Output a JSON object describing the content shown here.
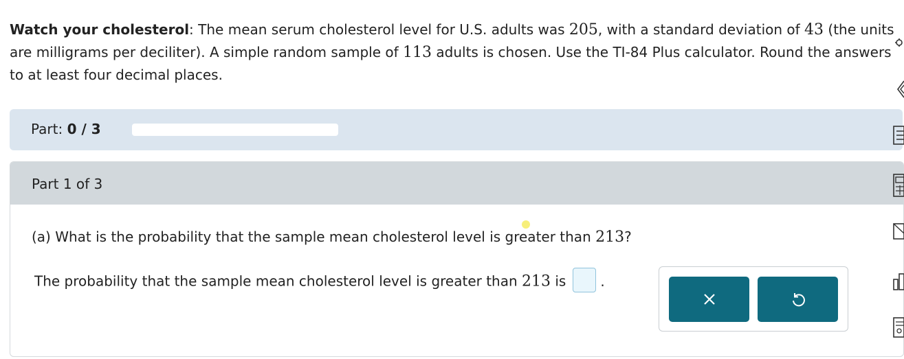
{
  "intro": {
    "title": "Watch your cholesterol",
    "colon": ": ",
    "t1": "The mean serum cholesterol level for U.S. adults was ",
    "mean": "205",
    "t2": ", with a standard deviation of ",
    "sd": "43",
    "t3": " (the units are milligrams per deciliter). A simple random sample of ",
    "n": "113",
    "t4": " adults is chosen. Use the TI-84 Plus calculator. Round the answers to at least four decimal places."
  },
  "part_bar": {
    "label": "Part: ",
    "progress_text": "0 / 3",
    "completed": 0,
    "total": 3,
    "colors": {
      "background": "#dbe5ef",
      "fill": "#2f7bbf"
    }
  },
  "question": {
    "part_title": "Part 1 of 3",
    "prompt": "(a) What is the probability that the sample mean cholesterol level is greater than ",
    "threshold": "213",
    "prompt_end": "?",
    "answer_prefix": "The probability that the sample mean cholesterol level is greater than ",
    "answer_mid": " is",
    "answer_value": "",
    "answer_suffix": "."
  },
  "tools": {
    "clear_icon": "x-icon",
    "undo_icon": "undo-icon",
    "button_color": "#0f6a7f"
  },
  "side_toolbar": {
    "icons": [
      "settings-icon",
      "text-reader-icon",
      "notes-icon",
      "calculator-icon",
      "message-icon",
      "chart-icon",
      "ebook-icon"
    ]
  }
}
